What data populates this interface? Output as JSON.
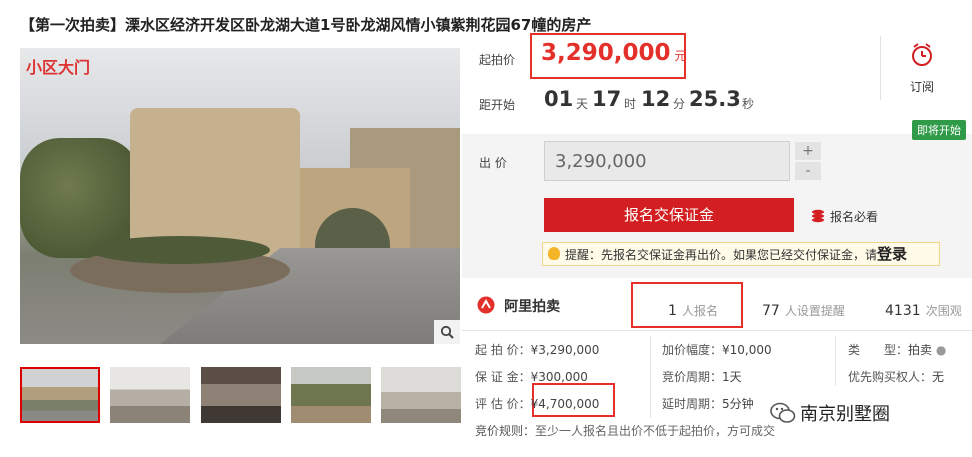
{
  "title": "【第一次拍卖】溧水区经济开发区卧龙湖大道1号卧龙湖风情小镇紫荆花园67幢的房产",
  "photo": {
    "tag": "小区大门"
  },
  "price": {
    "label": "起拍价",
    "value": "3,290,000",
    "unit": "元"
  },
  "subscribe": {
    "label": "订阅"
  },
  "countdown": {
    "label": "距开始",
    "days": "01",
    "days_unit": "天",
    "hours": "17",
    "hours_unit": "时",
    "minutes": "12",
    "minutes_unit": "分",
    "seconds": "25.3",
    "seconds_unit": "秒"
  },
  "badge": "即将开始",
  "bid": {
    "label": "出 价",
    "value": "3,290,000",
    "plus": "+",
    "minus": "-",
    "signup_button": "报名交保证金",
    "must_read": "报名必看",
    "tip_prefix": "提醒：先报名交保证金再出价。如果您已经交付保证金，请",
    "tip_login": "登录"
  },
  "platform": {
    "name": "阿里拍卖"
  },
  "stats": [
    {
      "num": "1",
      "label": "人报名"
    },
    {
      "num": "77",
      "label": "人设置提醒"
    },
    {
      "num": "4131",
      "label": "次围观"
    }
  ],
  "details": {
    "start_price": {
      "k": "起 拍 价：",
      "v": "¥3,290,000"
    },
    "deposit": {
      "k": "保 证 金：",
      "v": "¥300,000"
    },
    "appraisal": {
      "k": "评 估 价：",
      "v": "¥4,700,000"
    },
    "increment": {
      "k": "加价幅度：",
      "v": "¥10,000"
    },
    "bid_period": {
      "k": "竞价周期：",
      "v": "1天"
    },
    "delay_period": {
      "k": "延时周期：",
      "v": "5分钟"
    },
    "type": {
      "k": "类　　型：",
      "v": "拍卖"
    },
    "priority": {
      "k": "优先购买权人：",
      "v": "无"
    },
    "rule": {
      "k": "竞价规则：",
      "v": "至少一人报名且出价不低于起拍价，方可成交"
    }
  },
  "watermark": "南京别墅圈",
  "colors": {
    "accent": "#e4302a",
    "button": "#d31f21",
    "badge": "#2f9a47"
  }
}
